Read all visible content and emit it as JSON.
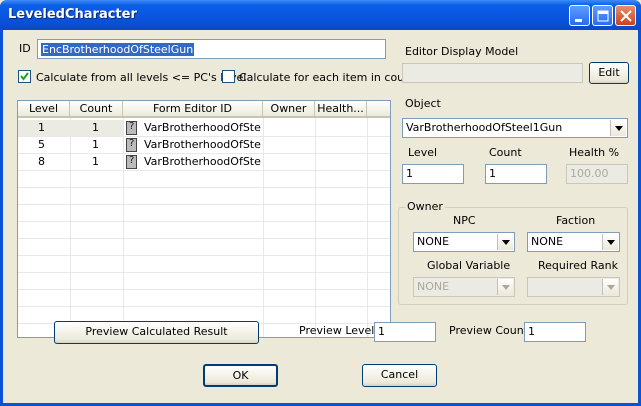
{
  "window": {
    "title": "LeveledCharacter"
  },
  "id_field": {
    "label": "ID",
    "value": "EncBrotherhoodOfSteelGun"
  },
  "checkboxes": {
    "calc_all_levels": {
      "label": "Calculate from all levels <= PC's level",
      "checked": true
    },
    "calc_each_item": {
      "label": "Calculate for each item in count",
      "checked": false
    }
  },
  "list": {
    "headers": [
      "Level",
      "Count",
      "Form Editor ID",
      "Owner",
      "Health..."
    ],
    "rows": [
      {
        "level": "1",
        "count": "1",
        "form_id": "VarBrotherhoodOfSte...",
        "owner": "",
        "health": ""
      },
      {
        "level": "5",
        "count": "1",
        "form_id": "VarBrotherhoodOfSte...",
        "owner": "",
        "health": ""
      },
      {
        "level": "8",
        "count": "1",
        "form_id": "VarBrotherhoodOfSte...",
        "owner": "",
        "health": ""
      }
    ]
  },
  "editor_display_model": {
    "label": "Editor Display Model",
    "value": "",
    "edit_button": "Edit"
  },
  "object": {
    "label": "Object",
    "value": "VarBrotherhoodOfSteel1Gun"
  },
  "fields": {
    "level": {
      "label": "Level",
      "value": "1"
    },
    "count": {
      "label": "Count",
      "value": "1"
    },
    "health": {
      "label": "Health %",
      "value": "100.00"
    }
  },
  "owner": {
    "group_label": "Owner",
    "npc_label": "NPC",
    "npc_value": "NONE",
    "faction_label": "Faction",
    "faction_value": "NONE",
    "global_variable_label": "Global Variable",
    "global_variable_value": "NONE",
    "required_rank_label": "Required Rank",
    "required_rank_value": ""
  },
  "preview": {
    "button": "Preview Calculated Result",
    "level_label": "Preview Level",
    "level_value": "1",
    "count_label": "Preview Count",
    "count_value": "1"
  },
  "actions": {
    "ok": "OK",
    "cancel": "Cancel"
  }
}
